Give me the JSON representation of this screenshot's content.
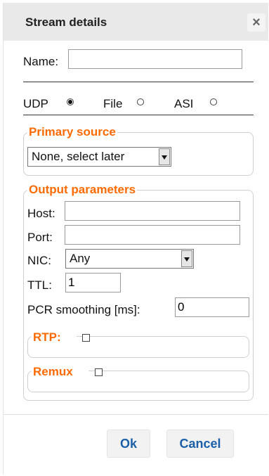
{
  "dialog": {
    "title": "Stream details",
    "close_label": "×"
  },
  "name_field": {
    "label": "Name:",
    "value": ""
  },
  "source_type": {
    "options": [
      {
        "label": "UDP",
        "checked": true
      },
      {
        "label": "File",
        "checked": false
      },
      {
        "label": "ASI",
        "checked": false
      }
    ]
  },
  "primary_source": {
    "legend": "Primary source",
    "select_value": "None, select later"
  },
  "output_parameters": {
    "legend": "Output parameters",
    "host": {
      "label": "Host:",
      "value": ""
    },
    "port": {
      "label": "Port:",
      "value": ""
    },
    "nic": {
      "label": "NIC:",
      "value": "Any"
    },
    "ttl": {
      "label": "TTL:",
      "value": "1"
    },
    "pcr": {
      "label": "PCR smoothing [ms]:",
      "value": "0"
    },
    "rtp": {
      "label": "RTP:",
      "checked": false
    },
    "remux": {
      "label": "Remux",
      "checked": false
    }
  },
  "buttons": {
    "ok": "Ok",
    "cancel": "Cancel"
  }
}
